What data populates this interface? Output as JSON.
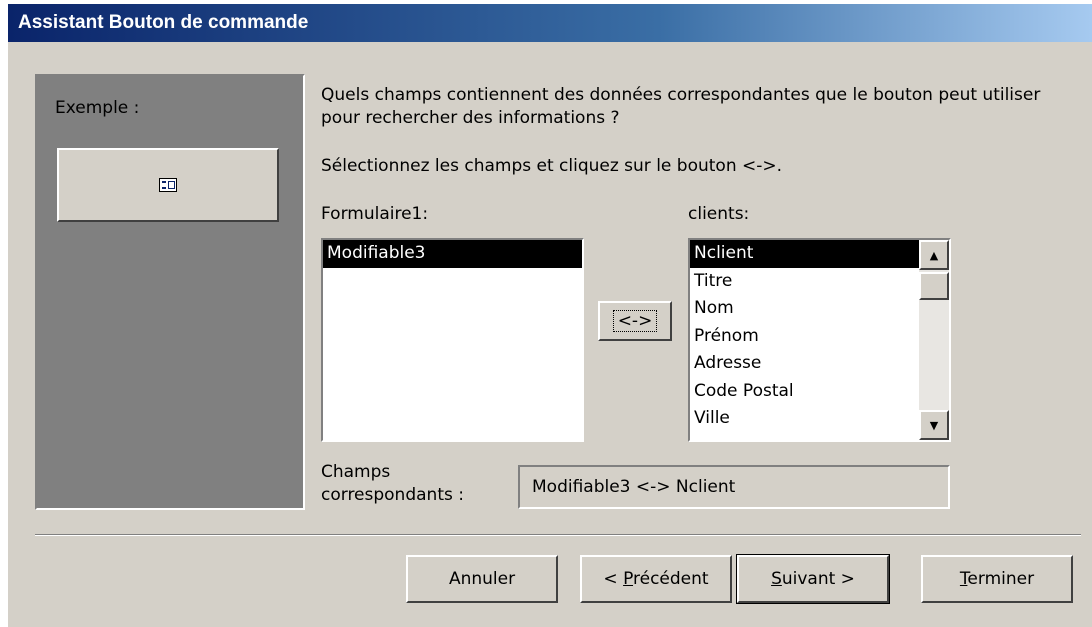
{
  "window": {
    "title": "Assistant Bouton de commande"
  },
  "example": {
    "label": "Exemple :",
    "icon": "form-icon"
  },
  "prompt": {
    "question": "Quels champs contiennent des données correspondantes que le bouton peut utiliser pour rechercher des informations ?",
    "instruction": "Sélectionnez les champs et cliquez sur le bouton <->."
  },
  "left_list": {
    "label": "Formulaire1:",
    "items": [
      "Modifiable3"
    ],
    "selected": "Modifiable3"
  },
  "swap_button": {
    "label": "<->"
  },
  "right_list": {
    "label": "clients:",
    "items": [
      "Nclient",
      "Titre",
      "Nom",
      "Prénom",
      "Adresse",
      "Code Postal",
      "Ville"
    ],
    "selected": "Nclient"
  },
  "matched": {
    "label": "Champs correspondants :",
    "value": "Modifiable3 <-> Nclient"
  },
  "buttons": {
    "cancel": {
      "label": "Annuler"
    },
    "back": {
      "prefix": "< ",
      "accel": "P",
      "rest": "récédent"
    },
    "next": {
      "accel": "S",
      "rest": "uivant >"
    },
    "finish": {
      "accel": "T",
      "rest": "erminer"
    }
  }
}
